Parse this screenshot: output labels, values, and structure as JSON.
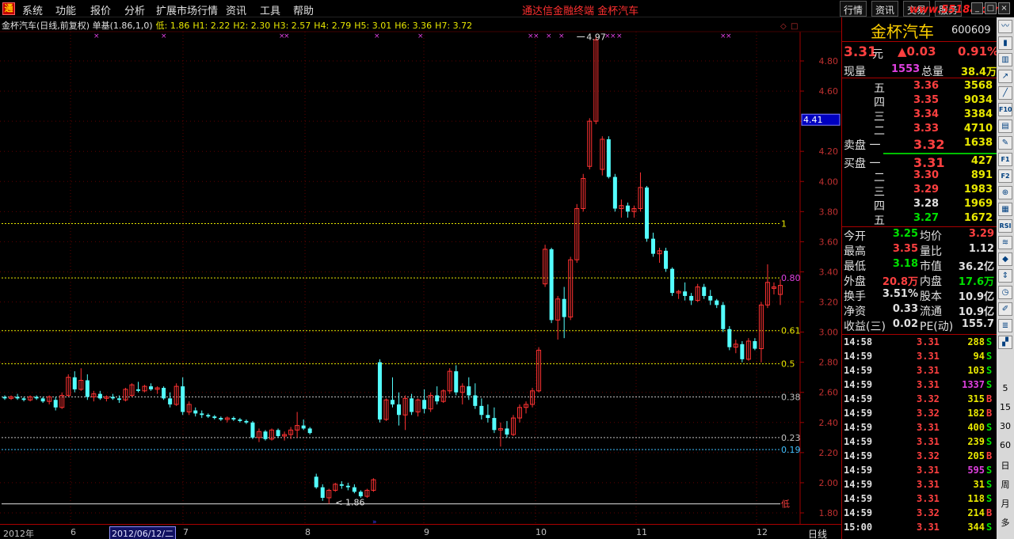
{
  "menu": {
    "items": [
      "系统",
      "功能",
      "报价",
      "分析",
      "扩展市场行情",
      "资讯",
      "工具",
      "帮助"
    ],
    "title": "通达信金融终端   金杯汽车",
    "tabs": [
      "行情",
      "资讯",
      "交易",
      "服务"
    ],
    "watermark": "www.55188.com"
  },
  "chart": {
    "info": {
      "label": "金杯汽车(日线,前复权) 单基(1.86,1,0)",
      "low": "低: 1.86",
      "h1": "H1: 2.22",
      "h2": "H2: 2.30",
      "h3": "H3: 2.57",
      "h4": "H4: 2.79",
      "h5": "H5: 3.01",
      "h6": "H6: 3.36",
      "h7": "H7: 3.72"
    },
    "price_labels": [
      "4.80",
      "4.60",
      "4.40",
      "4.20",
      "4.00",
      "3.80",
      "3.60",
      "3.40",
      "3.20",
      "3.00",
      "2.80",
      "2.60",
      "2.40",
      "2.20",
      "2.00",
      "1.80"
    ],
    "current_price_tag": "4.41",
    "max_annotation": "4.97",
    "min_annotation": "1.86",
    "low_marker": "低",
    "fib_lines": [
      {
        "price": 3.72,
        "label": "1",
        "color": "#e8e800"
      },
      {
        "price": 3.36,
        "label": "0.80",
        "color": "#e8e800"
      },
      {
        "price": 3.01,
        "label": "0.61",
        "color": "#e8e800"
      },
      {
        "price": 2.79,
        "label": "0.5",
        "color": "#e8e800"
      },
      {
        "price": 2.57,
        "label": "0.38",
        "color": "#c0c0c0"
      },
      {
        "price": 2.3,
        "label": "0.23",
        "color": "#c0c0c0"
      },
      {
        "price": 2.22,
        "label": "0.19",
        "color": "#40c0ff"
      },
      {
        "price": 1.86,
        "label": "",
        "color": "#e0e0e0"
      }
    ],
    "date_labels": [
      {
        "text": "2012年",
        "pos": 4
      },
      {
        "text": "6",
        "pos": 89
      },
      {
        "text": "7",
        "pos": 231
      },
      {
        "text": "8",
        "pos": 385
      },
      {
        "text": "9",
        "pos": 535
      },
      {
        "text": "10",
        "pos": 676
      },
      {
        "text": "11",
        "pos": 803
      },
      {
        "text": "12",
        "pos": 955
      }
    ],
    "selected_date": "2012/06/12/二",
    "period": "日线"
  },
  "chart_data": {
    "type": "candlestick",
    "ylim": [
      1.75,
      5.0
    ],
    "candles": [
      [
        2.57,
        2.58,
        2.55,
        2.56
      ],
      [
        2.56,
        2.58,
        2.55,
        2.57
      ],
      [
        2.57,
        2.59,
        2.55,
        2.56
      ],
      [
        2.56,
        2.57,
        2.54,
        2.55
      ],
      [
        2.55,
        2.58,
        2.54,
        2.57
      ],
      [
        2.57,
        2.58,
        2.55,
        2.56
      ],
      [
        2.56,
        2.57,
        2.53,
        2.54
      ],
      [
        2.54,
        2.58,
        2.52,
        2.57
      ],
      [
        2.55,
        2.57,
        2.48,
        2.5
      ],
      [
        2.5,
        2.6,
        2.49,
        2.58
      ],
      [
        2.58,
        2.72,
        2.57,
        2.7
      ],
      [
        2.7,
        2.74,
        2.6,
        2.62
      ],
      [
        2.62,
        2.76,
        2.61,
        2.68
      ],
      [
        2.68,
        2.72,
        2.55,
        2.57
      ],
      [
        2.57,
        2.61,
        2.54,
        2.59
      ],
      [
        2.59,
        2.61,
        2.55,
        2.56
      ],
      [
        2.56,
        2.58,
        2.54,
        2.57
      ],
      [
        2.57,
        2.59,
        2.55,
        2.56
      ],
      [
        2.56,
        2.58,
        2.53,
        2.55
      ],
      [
        2.55,
        2.63,
        2.54,
        2.62
      ],
      [
        2.58,
        2.66,
        2.57,
        2.65
      ],
      [
        2.62,
        2.67,
        2.6,
        2.61
      ],
      [
        2.61,
        2.65,
        2.6,
        2.64
      ],
      [
        2.64,
        2.66,
        2.61,
        2.62
      ],
      [
        2.62,
        2.64,
        2.59,
        2.63
      ],
      [
        2.63,
        2.64,
        2.55,
        2.56
      ],
      [
        2.56,
        2.6,
        2.5,
        2.52
      ],
      [
        2.52,
        2.66,
        2.51,
        2.64
      ],
      [
        2.64,
        2.7,
        2.45,
        2.47
      ],
      [
        2.47,
        2.54,
        2.45,
        2.52
      ],
      [
        2.48,
        2.5,
        2.44,
        2.46
      ],
      [
        2.46,
        2.48,
        2.43,
        2.45
      ],
      [
        2.45,
        2.46,
        2.43,
        2.44
      ],
      [
        2.44,
        2.45,
        2.42,
        2.43
      ],
      [
        2.43,
        2.44,
        2.41,
        2.42
      ],
      [
        2.42,
        2.44,
        2.4,
        2.43
      ],
      [
        2.43,
        2.44,
        2.41,
        2.42
      ],
      [
        2.42,
        2.43,
        2.4,
        2.41
      ],
      [
        2.41,
        2.42,
        2.39,
        2.4
      ],
      [
        2.4,
        2.41,
        2.29,
        2.3
      ],
      [
        2.3,
        2.36,
        2.27,
        2.34
      ],
      [
        2.34,
        2.35,
        2.28,
        2.29
      ],
      [
        2.29,
        2.36,
        2.28,
        2.35
      ],
      [
        2.35,
        2.36,
        2.3,
        2.31
      ],
      [
        2.31,
        2.34,
        2.28,
        2.32
      ],
      [
        2.32,
        2.37,
        2.29,
        2.35
      ],
      [
        2.35,
        2.47,
        2.3,
        2.38
      ],
      [
        2.38,
        2.42,
        2.35,
        2.36
      ],
      [
        2.36,
        2.37,
        2.32,
        2.33
      ],
      [
        2.04,
        2.06,
        1.96,
        1.97
      ],
      [
        1.97,
        1.99,
        1.88,
        1.9
      ],
      [
        1.9,
        1.96,
        1.86,
        1.95
      ],
      [
        1.95,
        2.0,
        1.94,
        1.99
      ],
      [
        1.99,
        2.01,
        1.96,
        1.98
      ],
      [
        1.98,
        2.0,
        1.95,
        1.97
      ],
      [
        1.97,
        1.99,
        1.93,
        1.94
      ],
      [
        1.94,
        1.95,
        1.9,
        1.91
      ],
      [
        1.91,
        1.96,
        1.9,
        1.95
      ],
      [
        1.95,
        2.03,
        1.94,
        2.02
      ],
      [
        2.8,
        2.82,
        2.4,
        2.42
      ],
      [
        2.42,
        2.56,
        2.41,
        2.55
      ],
      [
        2.55,
        2.7,
        2.5,
        2.52
      ],
      [
        2.52,
        2.6,
        2.38,
        2.45
      ],
      [
        2.45,
        2.58,
        2.35,
        2.56
      ],
      [
        2.56,
        2.59,
        2.45,
        2.47
      ],
      [
        2.47,
        2.56,
        2.44,
        2.55
      ],
      [
        2.55,
        2.62,
        2.46,
        2.49
      ],
      [
        2.49,
        2.6,
        2.47,
        2.58
      ],
      [
        2.58,
        2.64,
        2.52,
        2.54
      ],
      [
        2.54,
        2.62,
        2.53,
        2.61
      ],
      [
        2.61,
        2.76,
        2.59,
        2.74
      ],
      [
        2.74,
        2.78,
        2.58,
        2.6
      ],
      [
        2.6,
        2.66,
        2.52,
        2.64
      ],
      [
        2.64,
        2.7,
        2.55,
        2.58
      ],
      [
        2.58,
        2.66,
        2.49,
        2.51
      ],
      [
        2.51,
        2.56,
        2.42,
        2.45
      ],
      [
        2.45,
        2.52,
        2.4,
        2.43
      ],
      [
        2.43,
        2.5,
        2.33,
        2.35
      ],
      [
        2.35,
        2.4,
        2.24,
        2.36
      ],
      [
        2.36,
        2.41,
        2.3,
        2.32
      ],
      [
        2.32,
        2.45,
        2.31,
        2.43
      ],
      [
        2.43,
        2.52,
        2.4,
        2.5
      ],
      [
        2.5,
        2.54,
        2.46,
        2.52
      ],
      [
        2.52,
        2.63,
        2.5,
        2.61
      ],
      [
        2.61,
        2.9,
        2.6,
        2.88
      ],
      [
        3.32,
        3.58,
        3.3,
        3.55
      ],
      [
        3.55,
        3.56,
        3.06,
        3.08
      ],
      [
        3.08,
        3.24,
        2.95,
        3.22
      ],
      [
        3.22,
        3.3,
        2.96,
        3.1
      ],
      [
        3.1,
        3.5,
        3.08,
        3.48
      ],
      [
        3.48,
        3.85,
        3.46,
        3.82
      ],
      [
        3.82,
        4.05,
        3.8,
        4.02
      ],
      [
        4.1,
        4.42,
        4.08,
        4.4
      ],
      [
        4.4,
        4.96,
        4.38,
        4.94
      ],
      [
        4.08,
        4.3,
        4.04,
        4.28
      ],
      [
        4.28,
        4.3,
        4.02,
        4.03
      ],
      [
        4.03,
        4.05,
        3.8,
        3.82
      ],
      [
        3.82,
        3.88,
        3.76,
        3.84
      ],
      [
        3.84,
        3.86,
        3.76,
        3.8
      ],
      [
        3.8,
        3.84,
        3.76,
        3.82
      ],
      [
        3.82,
        4.06,
        3.8,
        3.96
      ],
      [
        3.96,
        3.97,
        3.6,
        3.62
      ],
      [
        3.62,
        3.66,
        3.5,
        3.52
      ],
      [
        3.52,
        3.56,
        3.46,
        3.54
      ],
      [
        3.54,
        3.56,
        3.4,
        3.42
      ],
      [
        3.42,
        3.43,
        3.24,
        3.26
      ],
      [
        3.26,
        3.28,
        3.22,
        3.27
      ],
      [
        3.27,
        3.33,
        3.21,
        3.24
      ],
      [
        3.24,
        3.26,
        3.18,
        3.21
      ],
      [
        3.21,
        3.32,
        3.2,
        3.3
      ],
      [
        3.3,
        3.32,
        3.22,
        3.24
      ],
      [
        3.24,
        3.28,
        3.18,
        3.21
      ],
      [
        3.21,
        3.22,
        3.16,
        3.18
      ],
      [
        3.18,
        3.2,
        3.0,
        3.02
      ],
      [
        3.02,
        3.04,
        2.88,
        2.9
      ],
      [
        2.9,
        2.95,
        2.86,
        2.92
      ],
      [
        2.92,
        2.94,
        2.8,
        2.82
      ],
      [
        2.82,
        2.96,
        2.81,
        2.94
      ],
      [
        2.94,
        2.96,
        2.88,
        2.89
      ],
      [
        2.89,
        3.2,
        2.8,
        3.18
      ],
      [
        3.18,
        3.45,
        3.16,
        3.33
      ],
      [
        3.29,
        3.33,
        3.25,
        3.3
      ],
      [
        3.25,
        3.35,
        3.18,
        3.31
      ]
    ],
    "markers": [
      118,
      203,
      352,
      358,
      472,
      527,
      666,
      673,
      689,
      705,
      763,
      770,
      778,
      909,
      916
    ]
  },
  "quote": {
    "name": "金杯汽车",
    "code": "600609",
    "price": "3.31",
    "price_unit": "元",
    "change": "▲0.03",
    "change_pct": "0.91%",
    "vol_now_label": "现量",
    "vol_now": "1553",
    "vol_total_label": "总量",
    "vol_total": "38.4万",
    "asks": [
      {
        "label": "五",
        "price": "3.36",
        "vol": "3568"
      },
      {
        "label": "四",
        "price": "3.35",
        "vol": "9034"
      },
      {
        "label": "三",
        "price": "3.34",
        "vol": "3384"
      },
      {
        "label": "二",
        "price": "3.33",
        "vol": "4710"
      },
      {
        "label": "卖盘 一",
        "price": "3.32",
        "vol": "1638"
      }
    ],
    "bids": [
      {
        "label": "买盘 一",
        "price": "3.31",
        "vol": "427"
      },
      {
        "label": "二",
        "price": "3.30",
        "vol": "891"
      },
      {
        "label": "三",
        "price": "3.29",
        "vol": "1983"
      },
      {
        "label": "四",
        "price": "3.28",
        "vol": "1969"
      },
      {
        "label": "五",
        "price": "3.27",
        "vol": "1672"
      }
    ],
    "stats": [
      [
        "今开",
        "3.25",
        "均价",
        "3.29"
      ],
      [
        "最高",
        "3.35",
        "量比",
        "1.12"
      ],
      [
        "最低",
        "3.18",
        "市值",
        "36.2亿"
      ],
      [
        "外盘",
        "20.8万",
        "内盘",
        "17.6万"
      ],
      [
        "换手",
        "3.51%",
        "股本",
        "10.9亿"
      ],
      [
        "净资",
        "0.33",
        "流通",
        "10.9亿"
      ],
      [
        "收益(三)",
        "0.02",
        "PE(动)",
        "155.7"
      ]
    ],
    "trades": [
      [
        "14:58",
        "3.31",
        "288",
        "S"
      ],
      [
        "14:59",
        "3.31",
        "94",
        "S"
      ],
      [
        "14:59",
        "3.31",
        "103",
        "S"
      ],
      [
        "14:59",
        "3.31",
        "1337",
        "S"
      ],
      [
        "14:59",
        "3.32",
        "315",
        "B"
      ],
      [
        "14:59",
        "3.32",
        "182",
        "B"
      ],
      [
        "14:59",
        "3.31",
        "400",
        "S"
      ],
      [
        "14:59",
        "3.31",
        "239",
        "S"
      ],
      [
        "14:59",
        "3.32",
        "205",
        "B"
      ],
      [
        "14:59",
        "3.31",
        "595",
        "S"
      ],
      [
        "14:59",
        "3.31",
        "31",
        "S"
      ],
      [
        "14:59",
        "3.31",
        "118",
        "S"
      ],
      [
        "14:59",
        "3.32",
        "214",
        "B"
      ],
      [
        "15:00",
        "3.31",
        "344",
        "S"
      ]
    ]
  },
  "side_tools": {
    "icons": [
      "line-chart-icon",
      "candle-icon",
      "bar-icon",
      "trend-icon",
      "line-icon",
      "f10-icon",
      "doc-icon",
      "note-icon",
      "f1-icon",
      "f2-icon",
      "zoom-icon",
      "grid-icon",
      "rsi-icon",
      "pattern-icon",
      "diamond-icon",
      "arrows-icon",
      "clock-icon",
      "pen-icon",
      "fib-icon",
      "chart2-icon"
    ],
    "btn_texts": [
      "",
      "",
      "",
      "",
      "",
      "F10",
      "",
      "",
      "F1",
      "F2",
      "",
      "",
      "RSI",
      "",
      "",
      "",
      "",
      "",
      "",
      ""
    ],
    "periods": [
      "5",
      "15",
      "30",
      "60",
      "日",
      "周",
      "月",
      "多"
    ]
  }
}
